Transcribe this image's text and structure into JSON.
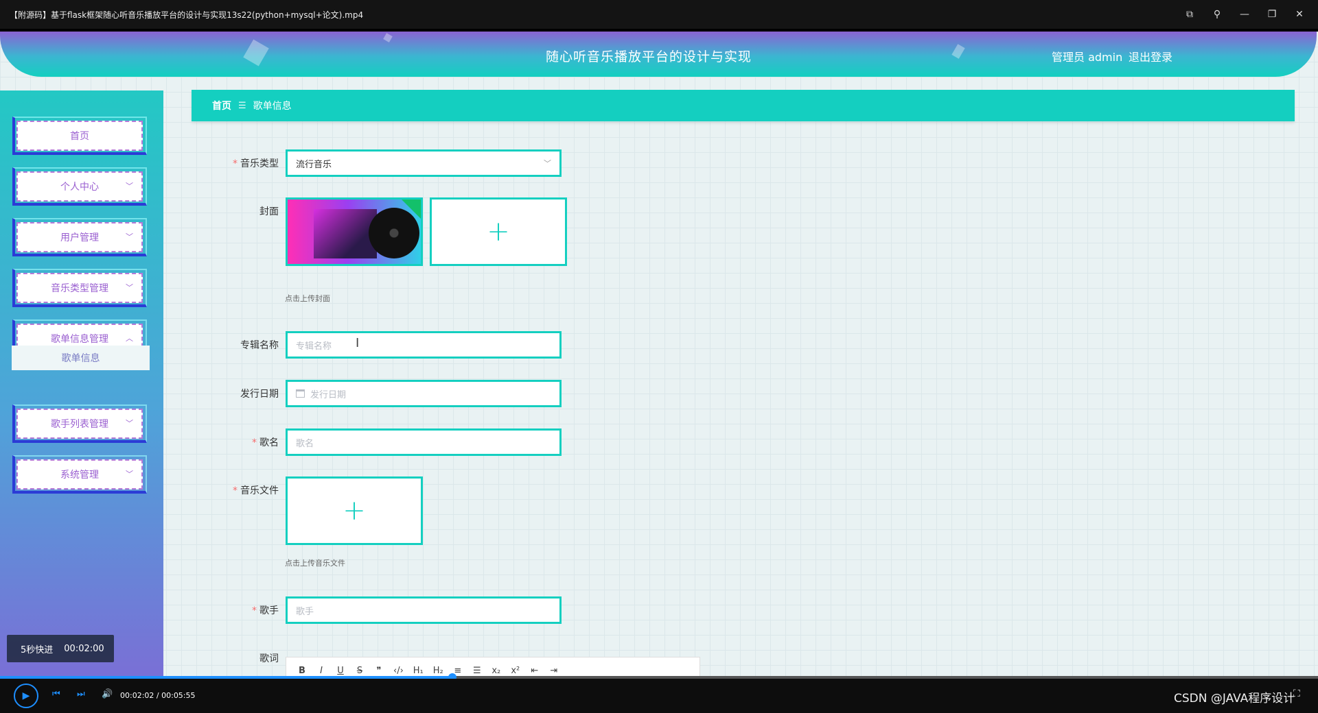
{
  "player": {
    "title": "【附源码】基于flask框架随心听音乐播放平台的设计与实现13s22(python+mysql+论文).mp4",
    "current_time": "00:02:02",
    "duration": "00:05:55",
    "time_sep": " / ",
    "progress_fraction": 0.343,
    "overlay_label": "5秒快进",
    "overlay_time": "00:02:00",
    "watermark": "CSDN @JAVA程序设计"
  },
  "header": {
    "app_title": "随心听音乐播放平台的设计与实现",
    "user_info": "管理员 admin",
    "logout": "退出登录"
  },
  "sidebar": {
    "items": [
      {
        "label": "首页",
        "has_chevron": false
      },
      {
        "label": "个人中心",
        "has_chevron": true
      },
      {
        "label": "用户管理",
        "has_chevron": true
      },
      {
        "label": "音乐类型管理",
        "has_chevron": true
      },
      {
        "label": "歌单信息管理",
        "has_chevron": true,
        "expanded": true
      },
      {
        "label": "歌手列表管理",
        "has_chevron": true
      },
      {
        "label": "系统管理",
        "has_chevron": true
      }
    ],
    "submenu_label": "歌单信息"
  },
  "breadcrumb": {
    "home": "首页",
    "current": "歌单信息"
  },
  "form": {
    "music_type": {
      "label": "音乐类型",
      "required": true,
      "value": "流行音乐"
    },
    "cover": {
      "label": "封面",
      "hint": "点击上传封面"
    },
    "album_name": {
      "label": "专辑名称",
      "placeholder": "专辑名称"
    },
    "release_date": {
      "label": "发行日期",
      "placeholder": "发行日期"
    },
    "song_name": {
      "label": "歌名",
      "required": true,
      "placeholder": "歌名"
    },
    "music_file": {
      "label": "音乐文件",
      "required": true,
      "hint": "点击上传音乐文件"
    },
    "singer": {
      "label": "歌手",
      "required": true,
      "placeholder": "歌手"
    },
    "lyrics": {
      "label": "歌词"
    }
  },
  "editor_toolbar": [
    "B",
    "I",
    "U",
    "S",
    "❞",
    "‹/›",
    "H₁",
    "H₂",
    "≡",
    "☰",
    "x₂",
    "x²",
    "⇤",
    "⇥"
  ]
}
